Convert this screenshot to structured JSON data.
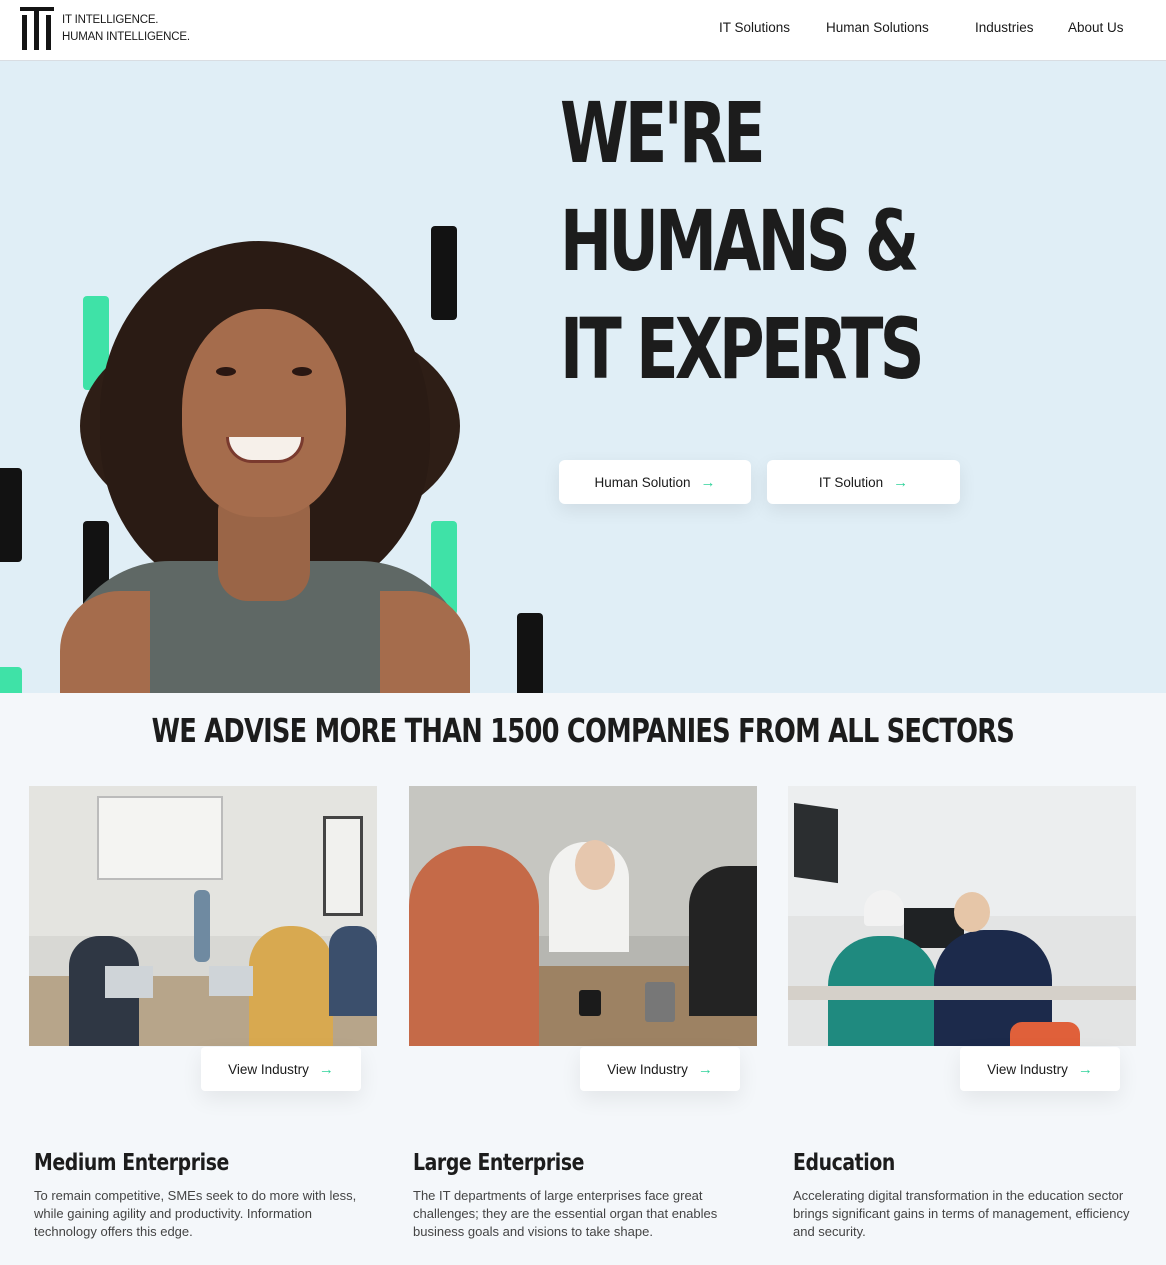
{
  "header": {
    "logo_line1": "IT INTELLIGENCE.",
    "logo_line2": "HUMAN INTELLIGENCE.",
    "nav": [
      "IT Solutions",
      "Human Solutions",
      "Industries",
      "About Us"
    ]
  },
  "hero": {
    "headline_lines": [
      "WE'RE",
      "HUMANS &",
      "IT EXPERTS"
    ],
    "buttons": [
      "Human Solution",
      "IT Solution"
    ]
  },
  "sectors": {
    "title": "WE ADVISE MORE THAN 1500 COMPANIES FROM ALL SECTORS",
    "cards": [
      {
        "button": "View Industry",
        "title": "Medium Enterprise",
        "description": "To remain competitive, SMEs seek to do more with less, while gaining agility and productivity. Information technology offers this edge."
      },
      {
        "button": "View Industry",
        "title": "Large Enterprise",
        "description": "The IT departments of large enterprises face great challenges; they are the essential organ that enables business goals and visions to take shape."
      },
      {
        "button": "View Industry",
        "title": "Education",
        "description": "Accelerating digital transformation in the education sector brings significant gains in terms of management, efficiency and security."
      }
    ]
  },
  "colors": {
    "accent": "#3fe2a7",
    "hero_background": "#e0eef6",
    "text": "#1c1c1c"
  },
  "icons": [
    "logo-mark",
    "arrow-right-icon"
  ]
}
